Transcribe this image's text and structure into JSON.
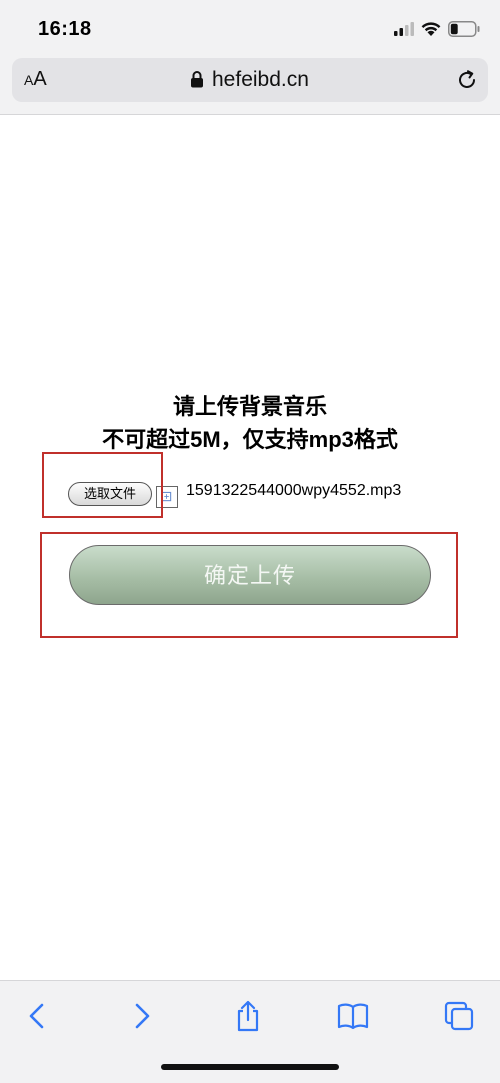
{
  "status_bar": {
    "time": "16:18",
    "signal_icon": "cellular-signal-icon",
    "wifi_icon": "wifi-icon",
    "battery_icon": "battery-icon",
    "battery_level": 0.3
  },
  "address_bar": {
    "aa_small": "A",
    "aa_large": "A",
    "domain": "hefeibd.cn",
    "lock_icon": "lock-icon",
    "reload_icon": "reload-icon"
  },
  "content": {
    "title_line1": "请上传背景音乐",
    "title_line2": "不可超过5M，仅支持mp3格式",
    "choose_file_label": "选取文件",
    "file_icon": "file-icon",
    "file_name": "1591322544000wpy4552.mp3",
    "upload_label": "确定上传"
  },
  "toolbar": {
    "back_icon": "back-chevron-icon",
    "forward_icon": "forward-chevron-icon",
    "share_icon": "share-icon",
    "bookmarks_icon": "book-icon",
    "tabs_icon": "tabs-icon"
  },
  "colors": {
    "highlight": "#c0302b",
    "accent": "#3478f6",
    "upload_button": "#a7bea6"
  }
}
